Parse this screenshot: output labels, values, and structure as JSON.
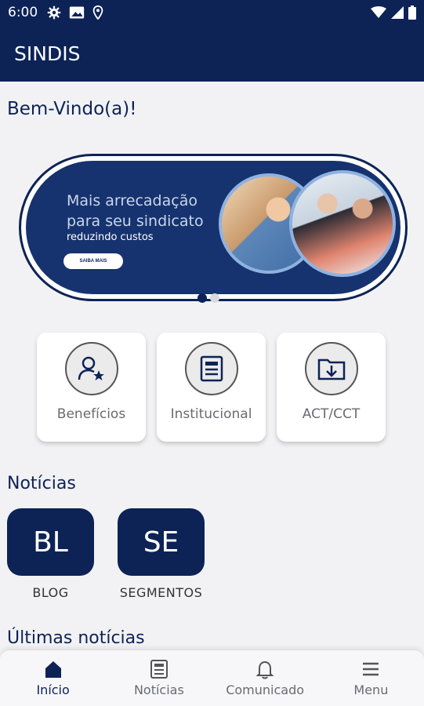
{
  "status_bar": {
    "time": "6:00"
  },
  "app_bar": {
    "title": "SINDIS"
  },
  "welcome": "Bem-Vindo(a)!",
  "banner": {
    "headline_line1": "Mais arrecadação",
    "headline_line2": "para seu sindicato",
    "subline": "reduzindo custos",
    "cta": "SAIBA MAIS",
    "slide_count": 2,
    "active_slide": 0
  },
  "quick_actions": [
    {
      "label": "Benefícios",
      "icon": "user-star-icon"
    },
    {
      "label": "Institucional",
      "icon": "document-icon"
    },
    {
      "label": "ACT/CCT",
      "icon": "folder-download-icon"
    }
  ],
  "news_section": {
    "title": "Notícias",
    "categories": [
      {
        "abbr": "BL",
        "label": "BLOG"
      },
      {
        "abbr": "SE",
        "label": "SEGMENTOS"
      }
    ]
  },
  "latest_news": {
    "title": "Últimas notícias"
  },
  "bottom_nav": [
    {
      "label": "Início",
      "icon": "home-icon",
      "active": true
    },
    {
      "label": "Notícias",
      "icon": "newspaper-icon",
      "active": false
    },
    {
      "label": "Comunicado",
      "icon": "bell-icon",
      "active": false
    },
    {
      "label": "Menu",
      "icon": "menu-icon",
      "active": false
    }
  ],
  "colors": {
    "primary": "#0d2356",
    "background": "#f2f2f4",
    "accent_border": "#8fb2e0"
  }
}
